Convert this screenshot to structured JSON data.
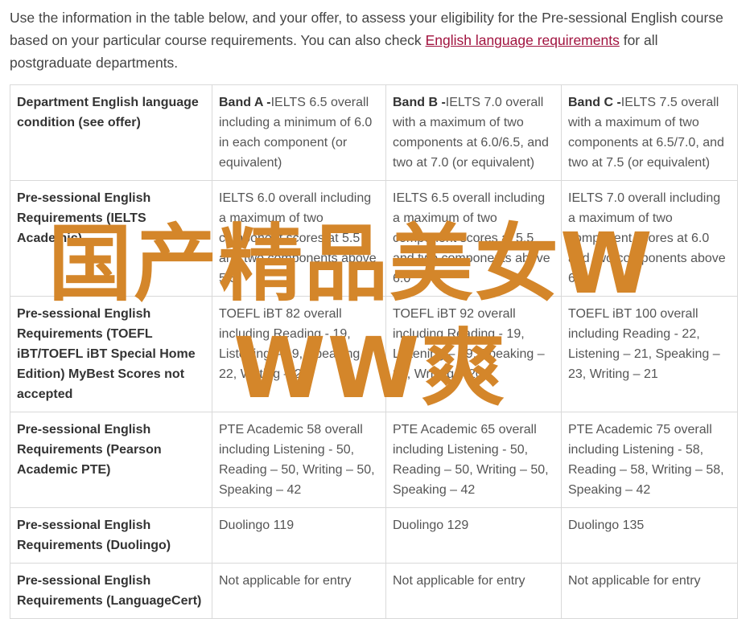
{
  "intro": {
    "text_before": "Use the information in the table below, and your offer, to assess your eligibility for the Pre-sessional English course based on your particular course requirements. You can also check ",
    "link_text": "English language requirements",
    "text_after": " for all postgraduate departments."
  },
  "table": {
    "header": {
      "label": "Department English language condition (see offer)",
      "bands": [
        {
          "name": "Band A -",
          "desc": "IELTS 6.5 overall including a minimum of 6.0 in each component (or equivalent)"
        },
        {
          "name": "Band B -",
          "desc": "IELTS 7.0 overall with a maximum of two components at 6.0/6.5, and two at 7.0 (or equivalent)"
        },
        {
          "name": "Band C -",
          "desc": "IELTS 7.5 overall with a maximum of two components at 6.5/7.0, and two at 7.5 (or equivalent)"
        }
      ]
    },
    "rows": [
      {
        "label": "Pre-sessional English Requirements (IELTS Academic)",
        "cells": [
          "IELTS 6.0 overall including a maximum of two component scores at 5.5 and two components above 5.5",
          "IELTS 6.5 overall including a maximum of two component scores at 5.5 and two components above 6.0",
          "IELTS 7.0 overall including a maximum of two component scores at 6.0 and two components above 6.0"
        ]
      },
      {
        "label": "Pre-sessional English Requirements (TOEFL iBT/TOEFL iBT Special Home Edition) MyBest Scores not accepted",
        "cells": [
          "TOEFL iBT 82 overall including Reading - 19, Listening – 19, Speaking – 22, Writing – 21",
          "TOEFL iBT 92 overall including Reading - 19, Listening – 19, Speaking – 22, Writing – 20",
          "TOEFL iBT 100 overall including Reading - 22, Listening – 21, Speaking – 23, Writing – 21"
        ]
      },
      {
        "label": "Pre-sessional English Requirements (Pearson Academic PTE)",
        "cells": [
          "PTE Academic 58 overall including Listening - 50, Reading – 50, Writing – 50, Speaking – 42",
          "PTE Academic 65 overall including Listening - 50, Reading – 50, Writing – 50, Speaking – 42",
          "PTE Academic 75 overall including Listening - 58, Reading – 58, Writing – 58, Speaking – 42"
        ]
      },
      {
        "label": "Pre-sessional English Requirements (Duolingo)",
        "cells": [
          "Duolingo 119",
          "Duolingo 129",
          "Duolingo 135"
        ]
      },
      {
        "label": "Pre-sessional English Requirements (LanguageCert)",
        "cells": [
          "Not applicable for entry",
          "Not applicable for entry",
          "Not applicable for entry"
        ]
      }
    ]
  },
  "watermark": {
    "line1": "国产精品美女W",
    "line2": "WW爽",
    "color": "#d4862a"
  }
}
